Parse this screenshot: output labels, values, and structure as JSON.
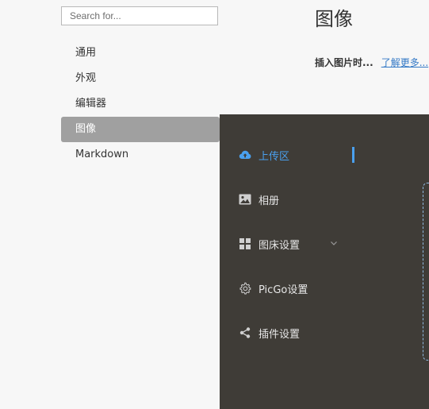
{
  "search": {
    "placeholder": "Search for..."
  },
  "settings_nav": {
    "items": [
      {
        "label": "通用"
      },
      {
        "label": "外观"
      },
      {
        "label": "编辑器"
      },
      {
        "label": "图像",
        "active": true
      },
      {
        "label": "Markdown"
      }
    ]
  },
  "main": {
    "title": "图像",
    "insert_label": "插入图片时...",
    "learn_more": "了解更多..."
  },
  "picgo": {
    "accent_color": "#4aa0ee",
    "background_color": "#3f3c37",
    "menu": [
      {
        "label": "上传区",
        "icon": "cloud-upload-icon",
        "active": true
      },
      {
        "label": "相册",
        "icon": "image-icon"
      },
      {
        "label": "图床设置",
        "icon": "grid-icon",
        "has_submenu": true
      },
      {
        "label": "PicGo设置",
        "icon": "gear-icon"
      },
      {
        "label": "插件设置",
        "icon": "share-icon"
      }
    ]
  }
}
